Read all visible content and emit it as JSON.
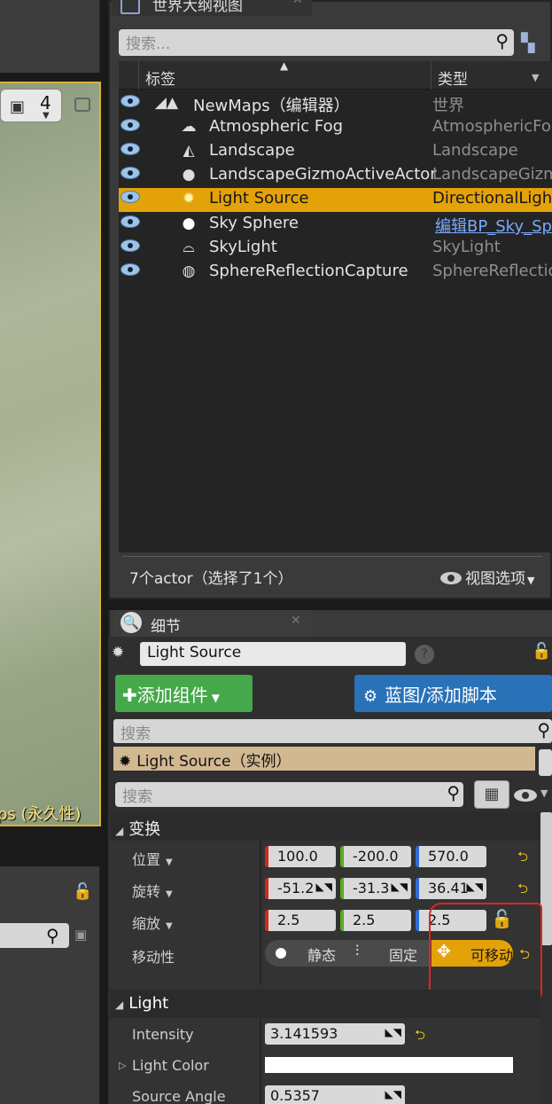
{
  "viewport": {
    "camera_speed": "4",
    "level_label": "ps (永久性)"
  },
  "outliner": {
    "tab_title": "世界大纲视图",
    "search_placeholder": "搜索...",
    "col_label": "标签",
    "col_type": "类型",
    "rows": [
      {
        "name": "NewMaps（编辑器）",
        "type": "世界",
        "icon": "world-icon"
      },
      {
        "name": "Atmospheric Fog",
        "type": "AtmosphericFog",
        "icon": "fog-icon"
      },
      {
        "name": "Landscape",
        "type": "Landscape",
        "icon": "landscape-icon"
      },
      {
        "name": "LandscapeGizmoActiveActor",
        "type": "LandscapeGizm",
        "icon": "gizmo-icon"
      },
      {
        "name": "Light Source",
        "type": "DirectionalLight",
        "icon": "light-icon",
        "selected": true
      },
      {
        "name": "Sky Sphere",
        "type": "编辑BP_Sky_Sp",
        "icon": "sphere-icon",
        "link": true
      },
      {
        "name": "SkyLight",
        "type": "SkyLight",
        "icon": "skylight-icon"
      },
      {
        "name": "SphereReflectionCapture",
        "type": "SphereReflection",
        "icon": "reflection-icon"
      }
    ],
    "actor_count": "7个actor（选择了1个）",
    "view_options": "视图选项"
  },
  "details": {
    "tab_title": "细节",
    "actor_name": "Light Source",
    "add_component": "添加组件",
    "blueprint": "蓝图/添加脚本",
    "component_search_placeholder": "搜索",
    "component_instance": "Light Source（实例）",
    "property_search_placeholder": "搜索",
    "transform": {
      "title": "变换",
      "location_label": "位置",
      "rotation_label": "旋转",
      "scale_label": "缩放",
      "mobility_label": "移动性",
      "location": [
        "100.0",
        "-200.0",
        "570.0"
      ],
      "rotation": [
        "-51.2",
        "-31.3",
        "36.41"
      ],
      "scale": [
        "2.5",
        "2.5",
        "2.5"
      ],
      "mobility_static": "静态",
      "mobility_stationary": "固定",
      "mobility_movable": "可移动"
    },
    "light": {
      "title": "Light",
      "intensity_label": "Intensity",
      "intensity": "3.141593",
      "color_label": "Light Color",
      "source_angle_label": "Source Angle",
      "source_angle": "0.5357"
    }
  },
  "colors": {
    "selection": "#e3a208",
    "add_button": "#45a84a",
    "blueprint_button": "#2a72b8",
    "annotation": "#e02424"
  }
}
